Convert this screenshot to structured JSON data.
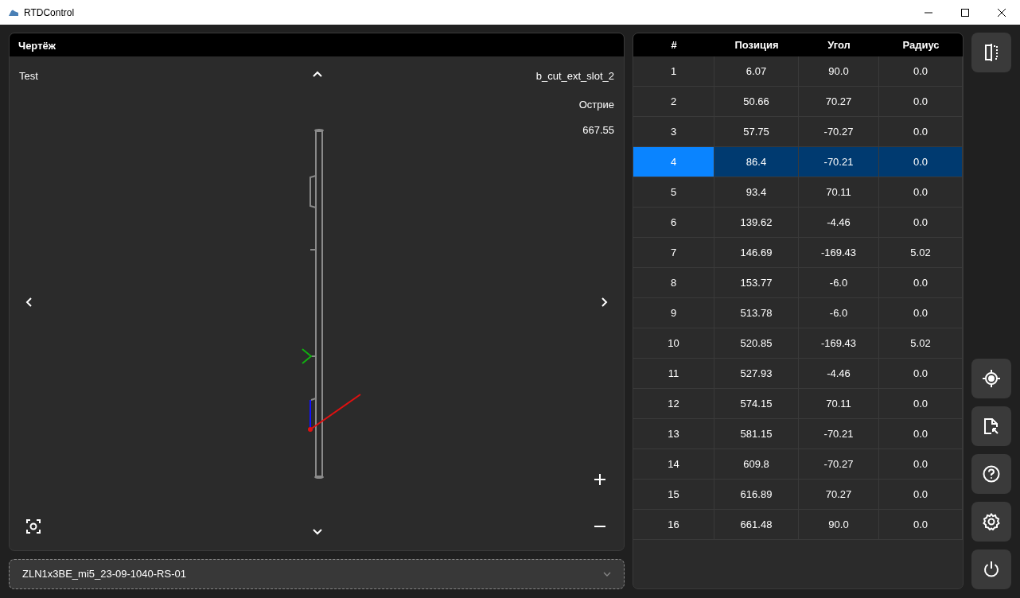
{
  "window": {
    "title": "RTDControl"
  },
  "drawing_panel": {
    "title": "Чертёж",
    "part_name": "Test",
    "contour": "b_cut_ext_slot_2",
    "tool": "Острие",
    "length": "667.55"
  },
  "program_select": {
    "value": "ZLN1x3BE_mi5_23-09-1040-RS-01"
  },
  "table": {
    "columns": [
      "#",
      "Позиция",
      "Угол",
      "Радиус"
    ],
    "rows": [
      {
        "cells": [
          "1",
          "6.07",
          "90.0",
          "0.0"
        ],
        "selected": false
      },
      {
        "cells": [
          "2",
          "50.66",
          "70.27",
          "0.0"
        ],
        "selected": false
      },
      {
        "cells": [
          "3",
          "57.75",
          "-70.27",
          "0.0"
        ],
        "selected": false
      },
      {
        "cells": [
          "4",
          "86.4",
          "-70.21",
          "0.0"
        ],
        "selected": true
      },
      {
        "cells": [
          "5",
          "93.4",
          "70.11",
          "0.0"
        ],
        "selected": false
      },
      {
        "cells": [
          "6",
          "139.62",
          "-4.46",
          "0.0"
        ],
        "selected": false
      },
      {
        "cells": [
          "7",
          "146.69",
          "-169.43",
          "5.02"
        ],
        "selected": false
      },
      {
        "cells": [
          "8",
          "153.77",
          "-6.0",
          "0.0"
        ],
        "selected": false
      },
      {
        "cells": [
          "9",
          "513.78",
          "-6.0",
          "0.0"
        ],
        "selected": false
      },
      {
        "cells": [
          "10",
          "520.85",
          "-169.43",
          "5.02"
        ],
        "selected": false
      },
      {
        "cells": [
          "11",
          "527.93",
          "-4.46",
          "0.0"
        ],
        "selected": false
      },
      {
        "cells": [
          "12",
          "574.15",
          "70.11",
          "0.0"
        ],
        "selected": false
      },
      {
        "cells": [
          "13",
          "581.15",
          "-70.21",
          "0.0"
        ],
        "selected": false
      },
      {
        "cells": [
          "14",
          "609.8",
          "-70.27",
          "0.0"
        ],
        "selected": false
      },
      {
        "cells": [
          "15",
          "616.89",
          "70.27",
          "0.0"
        ],
        "selected": false
      },
      {
        "cells": [
          "16",
          "661.48",
          "90.0",
          "0.0"
        ],
        "selected": false
      }
    ]
  }
}
